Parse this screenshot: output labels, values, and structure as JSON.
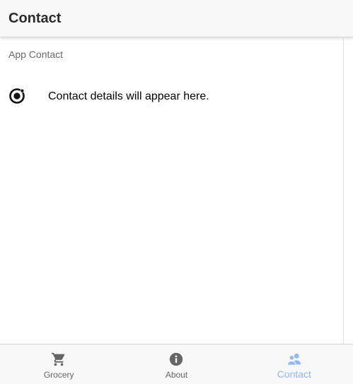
{
  "header": {
    "title": "Contact"
  },
  "content": {
    "list_header": "App Contact",
    "item": {
      "icon": "ionic-logo-icon",
      "label": "Contact details will appear here."
    }
  },
  "tabs": [
    {
      "label": "Grocery",
      "icon": "cart-icon",
      "active": false
    },
    {
      "label": "About",
      "icon": "info-icon",
      "active": false
    },
    {
      "label": "Contact",
      "icon": "people-icon",
      "active": true
    }
  ],
  "colors": {
    "active_tab": "#91b8f0",
    "inactive_tab": "#666666",
    "header_bg": "#f8f8f8"
  }
}
